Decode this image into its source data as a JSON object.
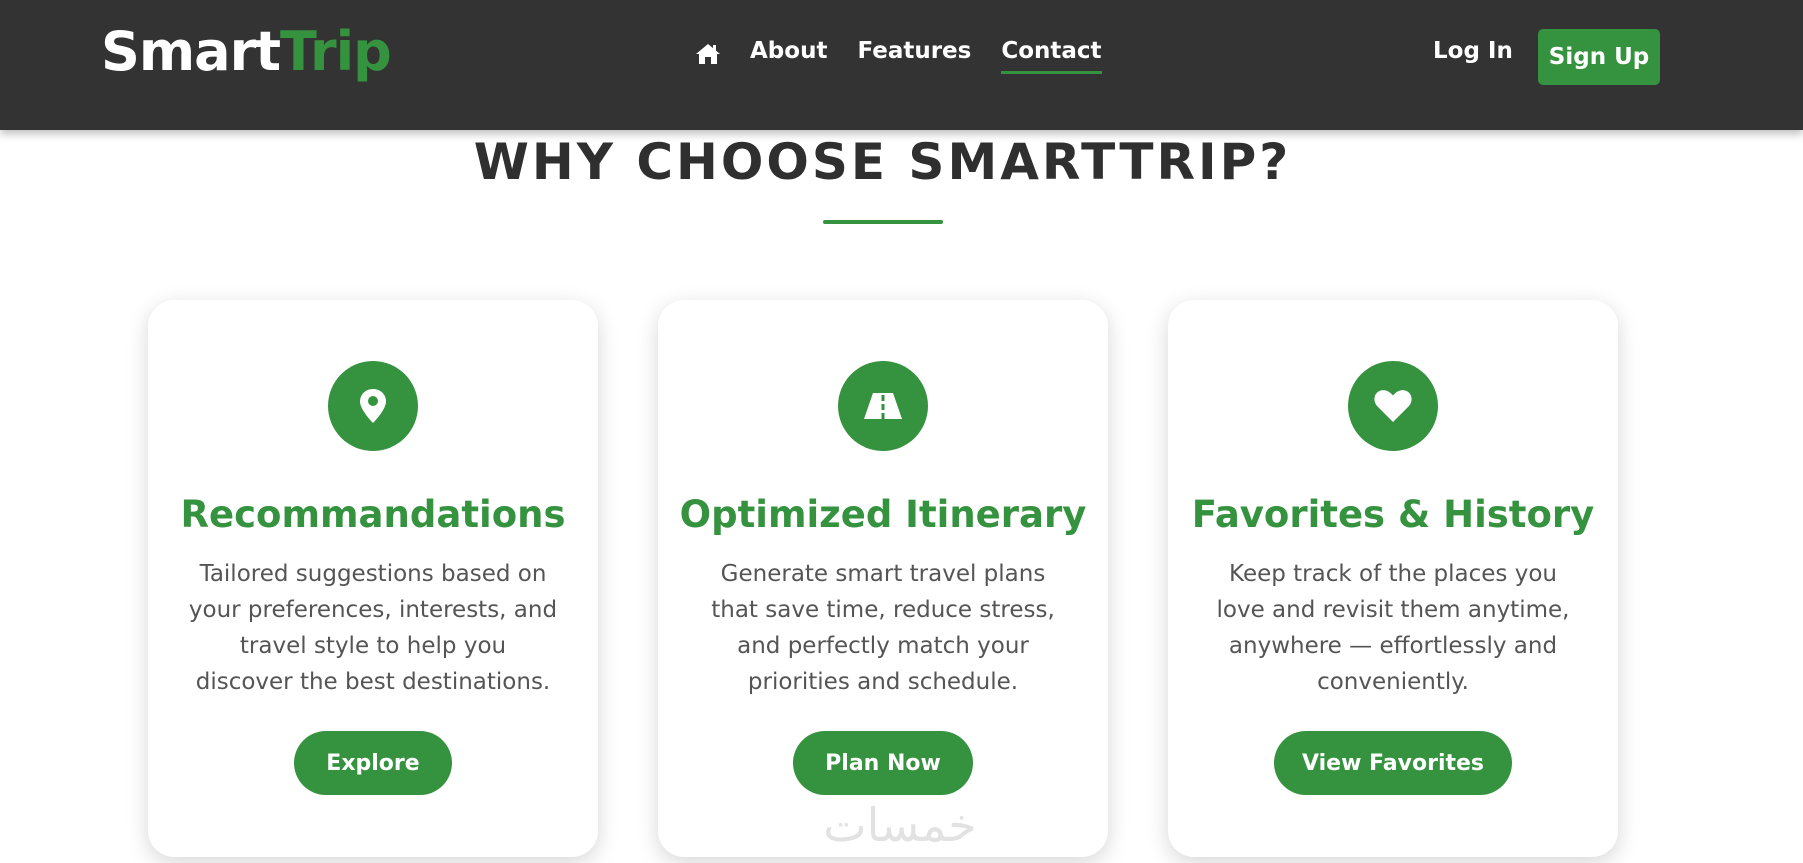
{
  "nav": {
    "logo_part1": "Smart",
    "logo_part2": "Trip",
    "home_icon": "home-icon",
    "links": [
      "About",
      "Features",
      "Contact"
    ],
    "active_link": "Contact",
    "login_label": "Log In",
    "signup_label": "Sign Up"
  },
  "section": {
    "title": "WHY CHOOSE SMARTTRIP?"
  },
  "cards": [
    {
      "icon": "map-pin-icon",
      "title": "Recommandations",
      "description": "Tailored suggestions based on your preferences, interests, and travel style to help you discover the best destinations.",
      "button": "Explore"
    },
    {
      "icon": "road-icon",
      "title": "Optimized Itinerary",
      "description": "Generate smart travel plans that save time, reduce stress, and perfectly match your priorities and schedule.",
      "button": "Plan Now"
    },
    {
      "icon": "heart-icon",
      "title": "Favorites & History",
      "description": "Keep track of the places you love and revisit them anytime, anywhere — effortlessly and conveniently.",
      "button": "View Favorites"
    }
  ],
  "watermark": "خمسات",
  "colors": {
    "navbar_bg": "#333333",
    "accent": "#35923f",
    "heading": "#2f2f2f",
    "body_text": "#555555"
  }
}
